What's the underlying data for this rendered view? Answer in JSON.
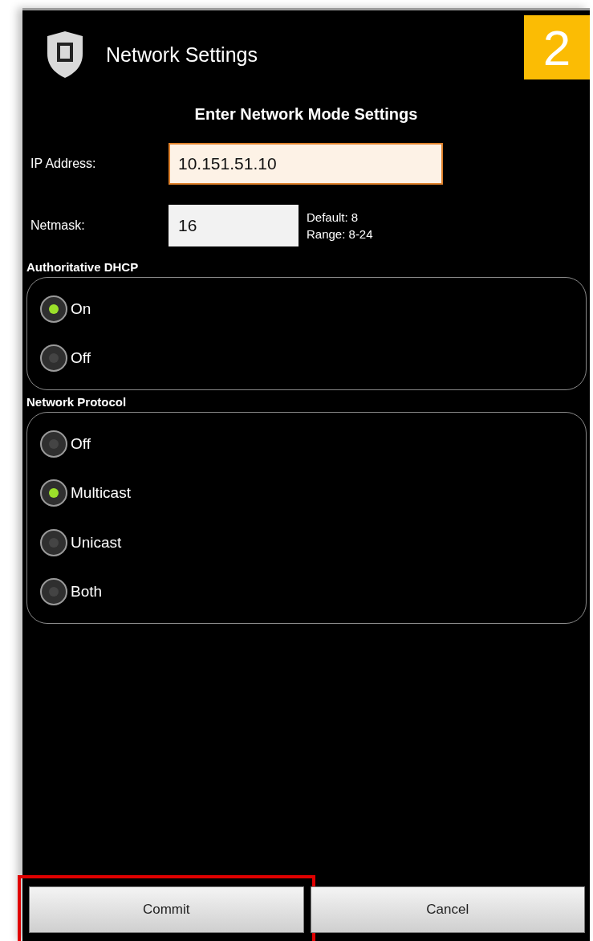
{
  "dialog": {
    "title": "Network Settings"
  },
  "step_badge": "2",
  "heading": "Enter Network Mode Settings",
  "fields": [
    {
      "label": "IP Address:",
      "value": "10.151.51.10",
      "focused": true
    },
    {
      "label": "Netmask:",
      "value": "16",
      "focused": false,
      "hints": [
        "Default: 8",
        "Range: 8-24"
      ]
    }
  ],
  "groups": [
    {
      "title": "Authoritative DHCP",
      "options": [
        {
          "label": "On",
          "selected": true
        },
        {
          "label": "Off",
          "selected": false
        }
      ]
    },
    {
      "title": "Network Protocol",
      "options": [
        {
          "label": "Off",
          "selected": false
        },
        {
          "label": "Multicast",
          "selected": true
        },
        {
          "label": "Unicast",
          "selected": false
        },
        {
          "label": "Both",
          "selected": false
        }
      ]
    }
  ],
  "buttons": [
    {
      "label": "Commit",
      "highlighted": true
    },
    {
      "label": "Cancel",
      "highlighted": false
    }
  ]
}
